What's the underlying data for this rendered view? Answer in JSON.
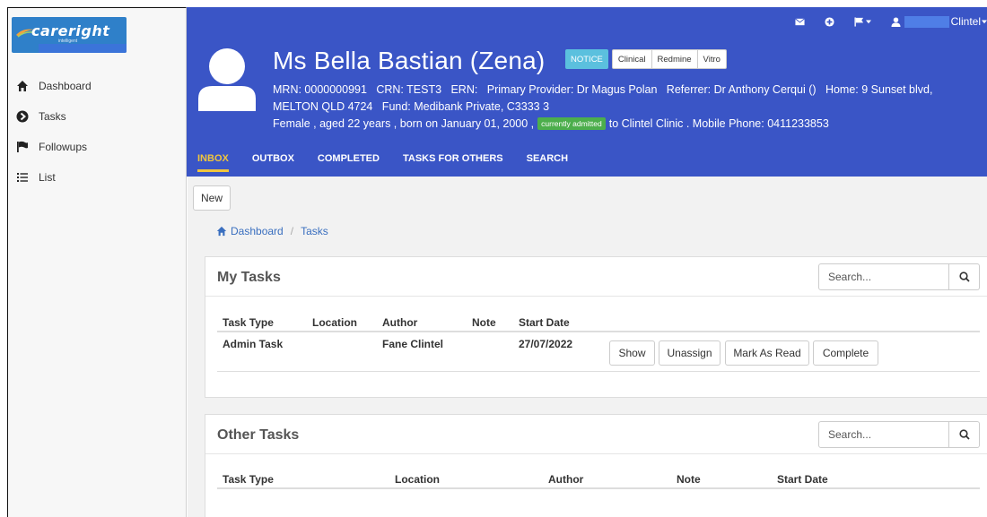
{
  "app": {
    "logo_text": "careright",
    "logo_sub": "intelligent"
  },
  "sidebar": {
    "items": [
      {
        "label": "Dashboard",
        "icon": "home-icon"
      },
      {
        "label": "Tasks",
        "icon": "circle-arrow-icon"
      },
      {
        "label": "Followups",
        "icon": "flag-icon"
      },
      {
        "label": "List",
        "icon": "list-icon"
      }
    ]
  },
  "topbar": {
    "user_name": "Clintel"
  },
  "patient": {
    "name": "Ms Bella Bastian (Zena)",
    "tags": {
      "notice": "NOTICE",
      "clinical": "Clinical",
      "redmine": "Redmine",
      "vitro": "Vitro"
    },
    "info_line1": "MRN: 0000000991   CRN: TEST3   ERN:   Primary Provider: Dr Magus Polan   Referrer: Dr Anthony Cerqui ()   Home: 9 Sunset blvd,",
    "info_line2": "MELTON QLD 4724   Fund: Medibank Private, C3333 3",
    "info_line3_a": "Female , aged 22 years , born on January 01, 2000 ,",
    "admitted_badge": "currently admitted",
    "info_line3_b": "to Clintel Clinic . Mobile Phone: 0411233853"
  },
  "tabs": [
    {
      "label": "INBOX",
      "active": true
    },
    {
      "label": "OUTBOX"
    },
    {
      "label": "COMPLETED"
    },
    {
      "label": "TASKS FOR OTHERS"
    },
    {
      "label": "SEARCH"
    }
  ],
  "main": {
    "new_label": "New",
    "breadcrumb": {
      "home": "Dashboard",
      "current": "Tasks"
    }
  },
  "my_tasks": {
    "title": "My Tasks",
    "search_placeholder": "Search...",
    "columns": [
      "Task Type",
      "Location",
      "Author",
      "Note",
      "Start Date"
    ],
    "rows": [
      {
        "task_type": "Admin Task",
        "location": "",
        "author": "Fane Clintel",
        "note": "",
        "start_date": "27/07/2022",
        "actions": [
          "Show",
          "Unassign",
          "Mark As Read",
          "Complete"
        ]
      }
    ]
  },
  "other_tasks": {
    "title": "Other Tasks",
    "search_placeholder": "Search...",
    "columns": [
      "Task Type",
      "Location",
      "Author",
      "Note",
      "Start Date"
    ]
  },
  "colors": {
    "header_bg": "#3a55c6",
    "active_tab": "#f0c53d",
    "notice": "#5bc0de",
    "admitted": "#4cae4c"
  }
}
